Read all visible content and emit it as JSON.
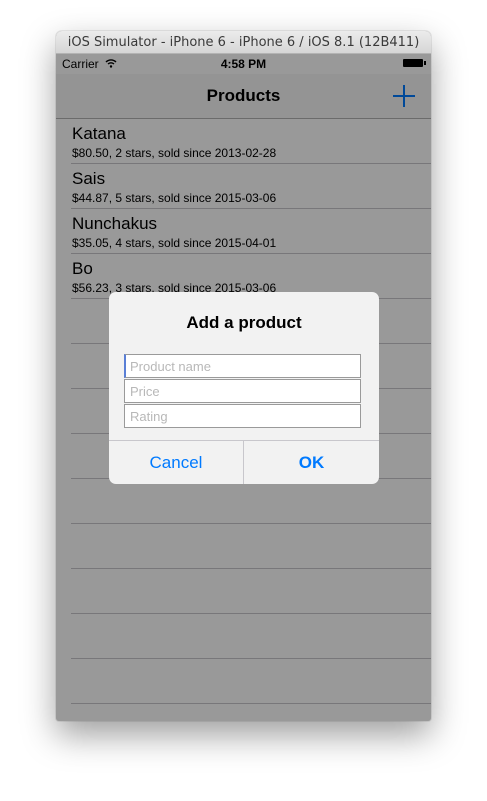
{
  "window": {
    "title": "iOS Simulator - iPhone 6 - iPhone 6 / iOS 8.1 (12B411)"
  },
  "status_bar": {
    "carrier": "Carrier",
    "time": "4:58 PM"
  },
  "nav": {
    "title": "Products",
    "add_icon": "plus-icon"
  },
  "products": [
    {
      "name": "Katana",
      "detail": "$80.50, 2 stars, sold since 2013-02-28"
    },
    {
      "name": "Sais",
      "detail": "$44.87, 5 stars, sold since 2015-03-06"
    },
    {
      "name": "Nunchakus",
      "detail": "$35.05, 4 stars, sold since 2015-04-01"
    },
    {
      "name": "Bo",
      "detail": "$56.23, 3 stars, sold since 2015-03-06"
    }
  ],
  "alert": {
    "title": "Add a product",
    "fields": [
      {
        "placeholder": "Product name",
        "value": ""
      },
      {
        "placeholder": "Price",
        "value": ""
      },
      {
        "placeholder": "Rating",
        "value": ""
      }
    ],
    "cancel_label": "Cancel",
    "ok_label": "OK"
  },
  "colors": {
    "accent": "#007aff",
    "separator": "#c8c7cc",
    "dim_overlay": "rgba(0,0,0,0.4)"
  }
}
